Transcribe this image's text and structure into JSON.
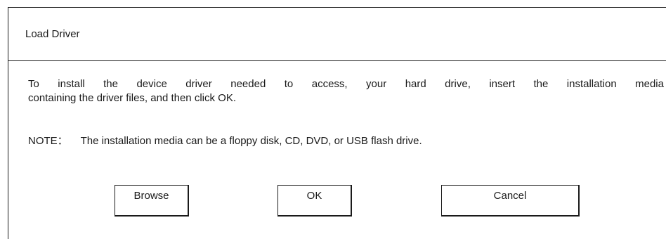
{
  "dialog": {
    "title": "Load Driver",
    "message_line1": "To install the device driver needed to access, your hard drive, insert the installation media",
    "message_line2": "containing the driver files, and then click OK.",
    "note_label": "NOTE：",
    "note_text": "The installation media can be a floppy disk, CD, DVD, or USB flash drive."
  },
  "buttons": {
    "browse": "Browse",
    "ok": "OK",
    "cancel": "Cancel"
  }
}
